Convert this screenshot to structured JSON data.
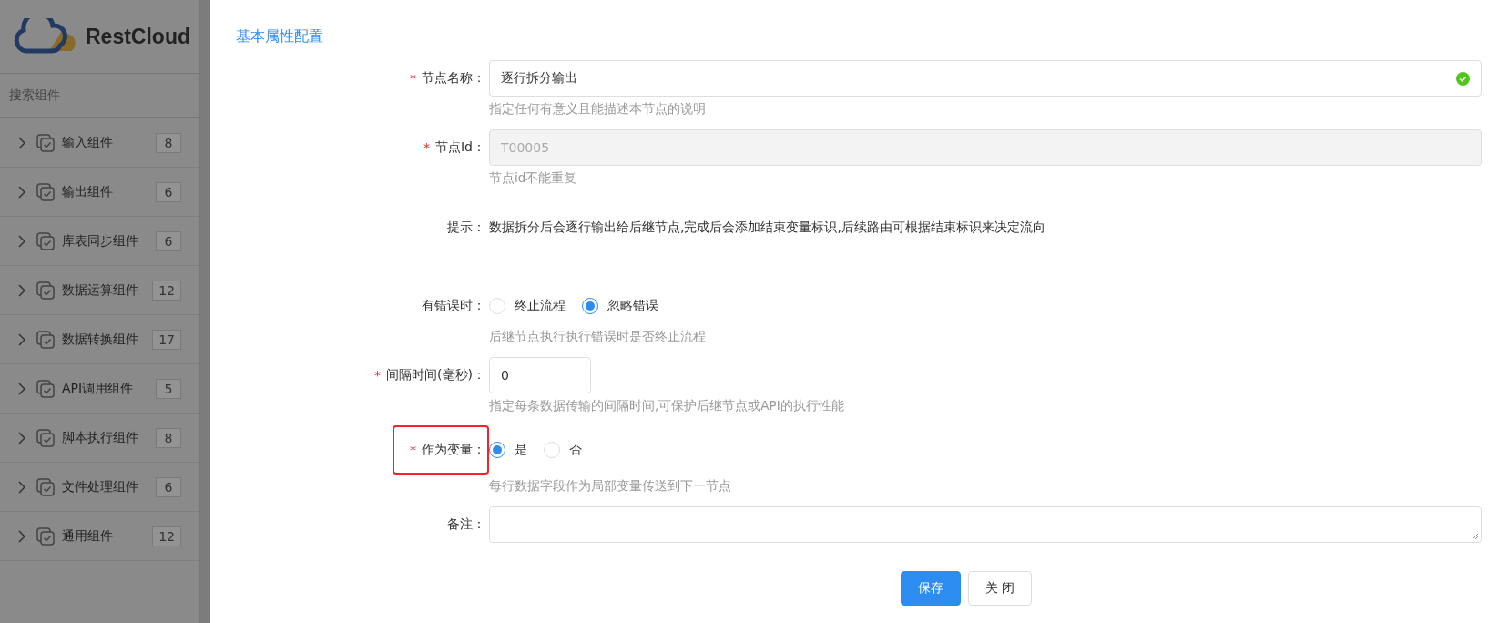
{
  "sidebar": {
    "logo_text": "RestCloud",
    "search_placeholder": "搜索组件",
    "groups": [
      {
        "label": "输入组件",
        "count": "8"
      },
      {
        "label": "输出组件",
        "count": "6"
      },
      {
        "label": "库表同步组件",
        "count": "6"
      },
      {
        "label": "数据运算组件",
        "count": "12"
      },
      {
        "label": "数据转换组件",
        "count": "17"
      },
      {
        "label": "API调用组件",
        "count": "5"
      },
      {
        "label": "脚本执行组件",
        "count": "8"
      },
      {
        "label": "文件处理组件",
        "count": "6"
      },
      {
        "label": "通用组件",
        "count": "12"
      }
    ]
  },
  "form": {
    "title": "基本属性配置",
    "fields": [
      {
        "kind": "text",
        "label": "节点名称：",
        "required_mark": "*",
        "highlighted": false,
        "value": "逐行拆分输出",
        "disabled": false,
        "valid": true,
        "wide": true,
        "hint": "指定任何有意义且能描述本节点的说明"
      },
      {
        "kind": "text",
        "label": "节点Id：",
        "required_mark": "*",
        "highlighted": false,
        "value": "T00005",
        "disabled": true,
        "valid": false,
        "wide": true,
        "hint": "节点id不能重复"
      },
      {
        "kind": "static",
        "label": "提示：",
        "highlighted": false,
        "text": "数据拆分后会逐行输出给后继节点,完成后会添加结束变量标识,后续路由可根据结束标识来决定流向"
      },
      {
        "kind": "radio",
        "label": "有错误时：",
        "highlighted": false,
        "options": [
          {
            "label": "终止流程",
            "selected": false
          },
          {
            "label": "忽略错误",
            "selected": true
          }
        ],
        "hint": "后继节点执行执行错误时是否终止流程"
      },
      {
        "kind": "text",
        "label": "间隔时间(毫秒)：",
        "required_mark": "*",
        "highlighted": false,
        "value": "0",
        "disabled": false,
        "valid": false,
        "wide": false,
        "hint": "指定每条数据传输的间隔时间,可保护后继节点或API的执行性能"
      },
      {
        "kind": "radio",
        "label": "作为变量：",
        "required_mark": "*",
        "highlighted": true,
        "options": [
          {
            "label": "是",
            "selected": true
          },
          {
            "label": "否",
            "selected": false
          }
        ],
        "hint": "每行数据字段作为局部变量传送到下一节点"
      },
      {
        "kind": "textarea",
        "label": "备注：",
        "highlighted": false
      }
    ],
    "buttons": [
      {
        "label": "保存",
        "kind": "primary"
      },
      {
        "label": "关 闭",
        "kind": "default"
      }
    ]
  }
}
